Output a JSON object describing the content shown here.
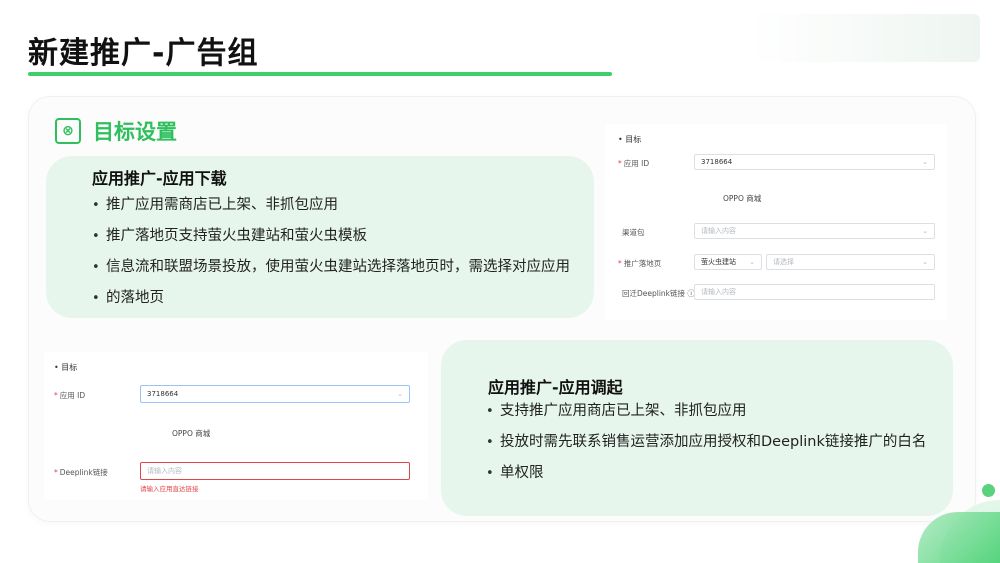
{
  "page": {
    "title": "新建推广-广告组"
  },
  "section": {
    "title": "目标设置",
    "icon": "target-settings-icon"
  },
  "download_box": {
    "title": "应用推广-应用下载",
    "bullets": [
      "推广应用需商店已上架、非抓包应用",
      "推广落地页支持萤火虫建站和萤火虫模板",
      "信息流和联盟场景投放，使用萤火虫建站选择落地页时，需选择对应应用",
      "的落地页"
    ]
  },
  "invoke_box": {
    "title": "应用推广-应用调起",
    "bullets": [
      "支持推广应用商店已上架、非抓包应用",
      "投放时需先联系销售运营添加应用授权和Deeplink链接推广的白名",
      "单权限"
    ]
  },
  "form_download": {
    "head": "• 目标",
    "app_id_label": "应用 ID",
    "app_id_value": "3718664",
    "app_name": "OPPO 商城",
    "channel_label": "渠道包",
    "channel_placeholder": "请输入内容",
    "landing_label": "推广落地页",
    "landing_type": "萤火虫建站",
    "landing_placeholder": "请选择",
    "deeplink_label": "回迁Deeplink链接 ⓘ",
    "deeplink_placeholder": "请输入内容"
  },
  "form_invoke": {
    "head": "• 目标",
    "app_id_label": "应用 ID",
    "app_id_value": "3718664",
    "app_name": "OPPO 商城",
    "deeplink_label": "Deeplink链接",
    "deeplink_placeholder": "请输入内容",
    "error_text": "请输入应用直达链接"
  },
  "colors": {
    "accent": "#3fcf6b",
    "box_bg": "#e6f6ec",
    "error": "#e0454a"
  }
}
